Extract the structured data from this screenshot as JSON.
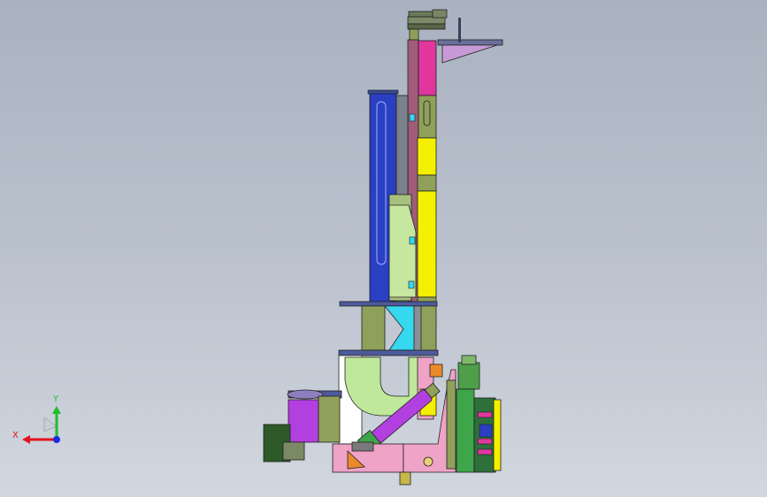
{
  "viewport": {
    "background_top": "#a9b2c0",
    "background_bottom": "#d2d7df"
  },
  "triad": {
    "x_label": "X",
    "y_label": "Y",
    "x_color": "#e0141e",
    "y_color": "#1fbf2a",
    "z_color": "#1a2ee0",
    "icon": "coordinate-triad-icon"
  },
  "palette": {
    "yellow": "#f4f000",
    "magenta": "#e0369e",
    "olive": "#8fa05a",
    "blue": "#2a3fc2",
    "cyan": "#35d8ef",
    "light_green": "#bfe89a",
    "purple": "#b23fe0",
    "pink": "#efa3c6",
    "dark_green": "#2d5a28",
    "orange": "#e98a2a",
    "green": "#3ea54a",
    "steel": "#4d5b9c"
  }
}
